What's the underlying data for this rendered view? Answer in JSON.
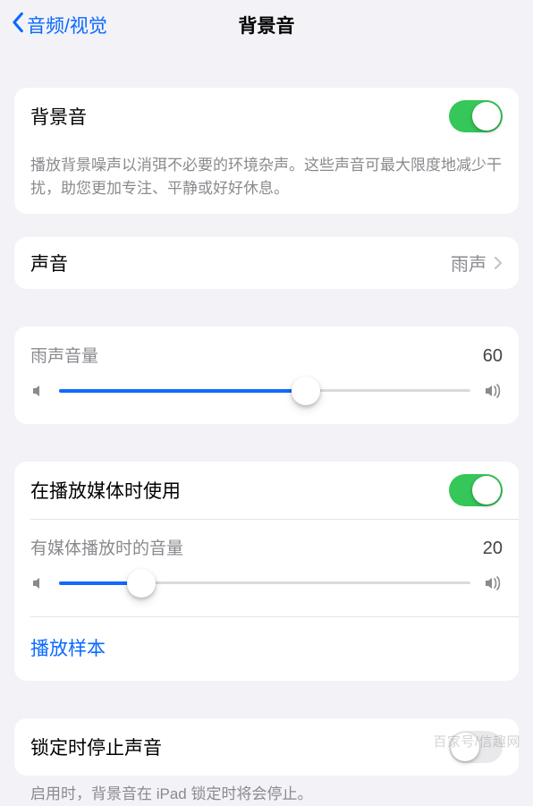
{
  "nav": {
    "back_label": "音频/视觉",
    "title": "背景音"
  },
  "bg": {
    "title": "背景音",
    "enabled": true,
    "desc": "播放背景噪声以消弭不必要的环境杂声。这些声音可最大限度地减少干扰，助您更加专注、平静或好好休息。"
  },
  "sound": {
    "label": "声音",
    "value": "雨声"
  },
  "volume": {
    "label": "雨声音量",
    "value": 60
  },
  "media": {
    "use_label": "在播放媒体时使用",
    "use_enabled": true,
    "vol_label": "有媒体播放时的音量",
    "vol_value": 20,
    "sample_label": "播放样本"
  },
  "lock": {
    "label": "锁定时停止声音",
    "enabled": false,
    "desc": "启用时，背景音在 iPad 锁定时将会停止。"
  },
  "watermark": "百家号/信趣网"
}
